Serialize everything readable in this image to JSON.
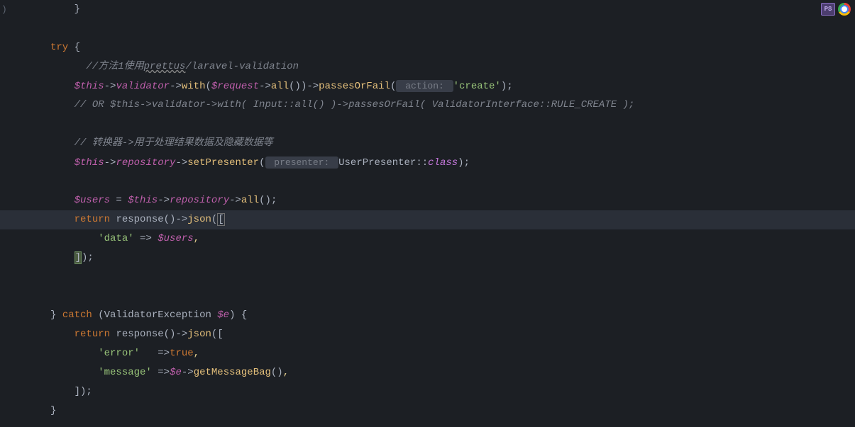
{
  "toolbar": {
    "ps_label": "PS"
  },
  "code": {
    "l1": "}",
    "l3_try": "try",
    "l3_brace": " {",
    "l4_comment": "//方法1使用",
    "l4_prettus": "prettus",
    "l4_rest": "/laravel-validation",
    "l5_this": "$this",
    "l5_arrow1": "->",
    "l5_validator": "validator",
    "l5_arrow2": "->",
    "l5_with": "with",
    "l5_p1": "(",
    "l5_request": "$request",
    "l5_arrow3": "->",
    "l5_all": "all",
    "l5_p2": "()",
    "l5_p3": ")",
    "l5_arrow4": "->",
    "l5_passes": "passesOrFail",
    "l5_p4": "(",
    "l5_hint": " action: ",
    "l5_create": "'create'",
    "l5_p5": ")",
    "l5_semi": ";",
    "l6_comment": "// OR $this->validator->with( Input::all() )->passesOrFail( ValidatorInterface::RULE_CREATE );",
    "l8_comment": "// 转换器->用于处理结果数据及隐藏数据等",
    "l9_this": "$this",
    "l9_arrow1": "->",
    "l9_repository": "repository",
    "l9_arrow2": "->",
    "l9_setPresenter": "setPresenter",
    "l9_p1": "(",
    "l9_hint": " presenter: ",
    "l9_userPresenter": "UserPresenter",
    "l9_dcolon": "::",
    "l9_class": "class",
    "l9_p2": ")",
    "l9_semi": ";",
    "l11_users": "$users",
    "l11_eq": " = ",
    "l11_this": "$this",
    "l11_arrow1": "->",
    "l11_repository": "repository",
    "l11_arrow2": "->",
    "l11_all": "all",
    "l11_p": "()",
    "l11_semi": ";",
    "l12_return": "return",
    "l12_response": "response",
    "l12_p1": "()",
    "l12_arrow": "->",
    "l12_json": "json",
    "l12_p2": "(",
    "l12_bracket": "[",
    "l13_data": "'data'",
    "l13_arrow": " => ",
    "l13_users": "$users",
    "l13_comma": ",",
    "l14_bracket": "]",
    "l14_p": ")",
    "l14_semi": ";",
    "l17_brace": "} ",
    "l17_catch": "catch",
    "l17_p1": " (",
    "l17_exception": "ValidatorException",
    "l17_e": " $e",
    "l17_p2": ") {",
    "l18_return": "return",
    "l18_response": "response",
    "l18_p1": "()",
    "l18_arrow": "->",
    "l18_json": "json",
    "l18_p2": "([",
    "l19_error": "'error'",
    "l19_sp": "   ",
    "l19_arrow": "=>",
    "l19_true": "true",
    "l19_comma": ",",
    "l20_message": "'message'",
    "l20_arrow": " =>",
    "l20_e": "$e",
    "l20_arr": "->",
    "l20_method": "getMessageBag",
    "l20_p": "()",
    "l20_comma": ",",
    "l21_bracket": "])",
    "l21_semi": ";",
    "l22_brace": "}"
  }
}
